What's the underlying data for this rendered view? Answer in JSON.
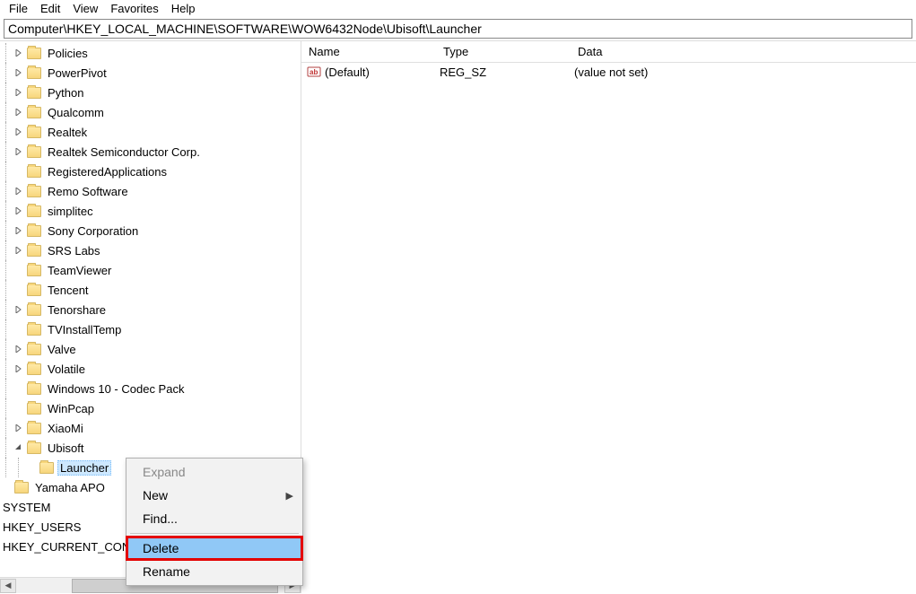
{
  "menubar": {
    "items": [
      "File",
      "Edit",
      "View",
      "Favorites",
      "Help"
    ]
  },
  "addressbar": {
    "path": "Computer\\HKEY_LOCAL_MACHINE\\SOFTWARE\\WOW6432Node\\Ubisoft\\Launcher"
  },
  "tree": {
    "items": [
      {
        "indent": 1,
        "chevron": ">",
        "label": "Policies"
      },
      {
        "indent": 1,
        "chevron": ">",
        "label": "PowerPivot"
      },
      {
        "indent": 1,
        "chevron": ">",
        "label": "Python"
      },
      {
        "indent": 1,
        "chevron": ">",
        "label": "Qualcomm"
      },
      {
        "indent": 1,
        "chevron": ">",
        "label": "Realtek"
      },
      {
        "indent": 1,
        "chevron": ">",
        "label": "Realtek Semiconductor Corp."
      },
      {
        "indent": 1,
        "chevron": "",
        "label": "RegisteredApplications",
        "leaf": true
      },
      {
        "indent": 1,
        "chevron": ">",
        "label": "Remo Software"
      },
      {
        "indent": 1,
        "chevron": ">",
        "label": "simplitec"
      },
      {
        "indent": 1,
        "chevron": ">",
        "label": "Sony Corporation"
      },
      {
        "indent": 1,
        "chevron": ">",
        "label": "SRS Labs"
      },
      {
        "indent": 1,
        "chevron": "",
        "label": "TeamViewer",
        "leaf": true
      },
      {
        "indent": 1,
        "chevron": "",
        "label": "Tencent",
        "leaf": true
      },
      {
        "indent": 1,
        "chevron": ">",
        "label": "Tenorshare"
      },
      {
        "indent": 1,
        "chevron": "",
        "label": "TVInstallTemp",
        "leaf": true
      },
      {
        "indent": 1,
        "chevron": ">",
        "label": "Valve"
      },
      {
        "indent": 1,
        "chevron": ">",
        "label": "Volatile"
      },
      {
        "indent": 1,
        "chevron": "",
        "label": "Windows 10 - Codec Pack",
        "leaf": true
      },
      {
        "indent": 1,
        "chevron": "",
        "label": "WinPcap",
        "leaf": true
      },
      {
        "indent": 1,
        "chevron": ">",
        "label": "XiaoMi"
      },
      {
        "indent": 1,
        "chevron": "v",
        "label": "Ubisoft"
      },
      {
        "indent": 2,
        "chevron": "",
        "label": "Launcher",
        "selected": true,
        "leaf": true
      },
      {
        "indent": 0,
        "chevron": "",
        "label": "Yamaha APO",
        "nofolderprefix": false
      },
      {
        "indent": -1,
        "chevron": "",
        "label": "SYSTEM",
        "plain": true
      },
      {
        "indent": -1,
        "chevron": "",
        "label": "HKEY_USERS",
        "plain": true,
        "cut": true
      },
      {
        "indent": -1,
        "chevron": "",
        "label": "HKEY_CURRENT_CON",
        "plain": true,
        "cut": true
      }
    ]
  },
  "columns": {
    "name": "Name",
    "type": "Type",
    "data": "Data"
  },
  "values": [
    {
      "name": "(Default)",
      "type": "REG_SZ",
      "data": "(value not set)"
    }
  ],
  "context_menu": {
    "items": [
      {
        "label": "Expand",
        "kind": "disabled"
      },
      {
        "label": "New",
        "kind": "submenu"
      },
      {
        "label": "Find...",
        "kind": "normal"
      },
      {
        "sep": true
      },
      {
        "label": "Delete",
        "kind": "highlight"
      },
      {
        "label": "Rename",
        "kind": "normal"
      }
    ]
  }
}
